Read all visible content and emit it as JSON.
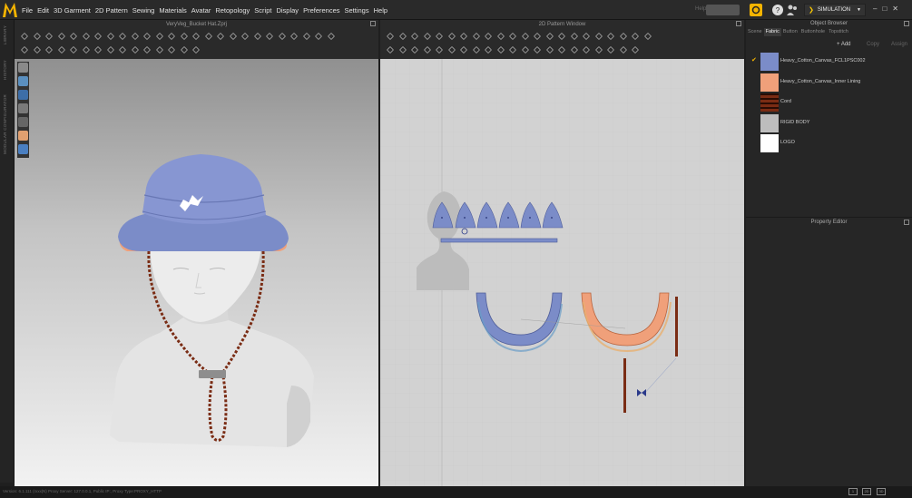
{
  "menu": [
    "File",
    "Edit",
    "3D Garment",
    "2D Pattern",
    "Sewing",
    "Materials",
    "Avatar",
    "Retopology",
    "Script",
    "Display",
    "Preferences",
    "Settings",
    "Help"
  ],
  "help_label": "Help",
  "simulation_label": "SIMULATION",
  "window_controls": [
    "–",
    "□",
    "✕"
  ],
  "win3d_title": "VeryVeg_Bucket Hat.Zprj",
  "win2d_title": "2D Pattern Window",
  "vertical_tabs": [
    "LIBRARY",
    "HISTORY",
    "MODULAR CONFIGURATOR"
  ],
  "object_browser": {
    "title": "Object Browser",
    "tabs": [
      "Scene",
      "Fabric",
      "Button",
      "Buttonhole",
      "Topstitch"
    ],
    "active_tab": "Fabric",
    "actions": [
      "+ Add",
      "Copy",
      "Assign"
    ],
    "fabrics": [
      {
        "name": "Heavy_Cotton_Canvas_FCL1PSC002",
        "color": "#7b8cc8",
        "selected": true,
        "check": "✔"
      },
      {
        "name": "Heavy_Cotton_Canvas_Inner Lining",
        "color": "#f0a07a",
        "selected": false
      },
      {
        "name": "Cord",
        "color": "#7a2c14",
        "selected": false
      },
      {
        "name": "RIGID BODY",
        "color": "#bdbdbd",
        "selected": false
      },
      {
        "name": "LOGO",
        "color": "#ffffff",
        "selected": false
      }
    ]
  },
  "property_editor_title": "Property Editor",
  "status_text": "Version: 6.1.111 (rxxx|N)   Proxy Server: 127.0.0.1, Public IP:, Proxy Type:PROXY_HTTP",
  "status_buttons": [
    "1",
    "2D",
    "3D"
  ],
  "colors": {
    "accent": "#ffcc00",
    "hat_blue": "#7b8cc8",
    "hat_lining": "#f0a07a",
    "cord": "#7a2c14",
    "pattern_bg": "#d2d2d2"
  }
}
